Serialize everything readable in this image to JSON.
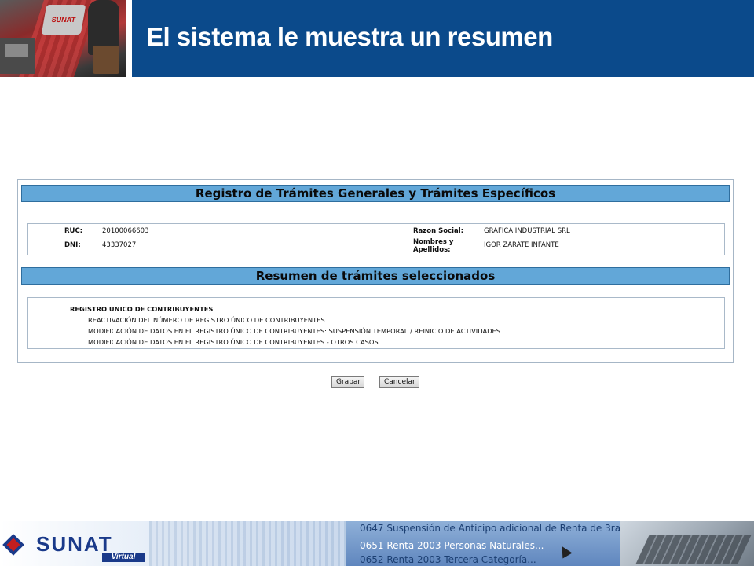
{
  "header": {
    "title": "El sistema le muestra un resumen",
    "photo_sign": "SUNAT"
  },
  "panel": {
    "section1_title": "Registro de Trámites Generales y Trámites Específicos",
    "fields": {
      "ruc_label": "RUC:",
      "ruc_value": "20100066603",
      "dni_label": "DNI:",
      "dni_value": "43337027",
      "razon_label": "Razon Social:",
      "razon_value": "GRAFICA INDUSTRIAL SRL",
      "nombres_label_1": "Nombres y",
      "nombres_label_2": "Apellidos:",
      "nombres_value": "IGOR ZARATE INFANTE"
    },
    "section2_title": "Resumen de trámites seleccionados",
    "summary": {
      "group": "REGISTRO UNICO DE CONTRIBUYENTES",
      "items": [
        "REACTIVACIÓN DEL NÚMERO DE REGISTRO ÚNICO DE CONTRIBUYENTES",
        "MODIFICACIÓN DE DATOS EN EL REGISTRO ÚNICO DE CONTRIBUYENTES: SUSPENSIÓN TEMPORAL / REINICIO DE ACTIVIDADES",
        "MODIFICACIÓN DE DATOS EN EL REGISTRO ÚNICO DE CONTRIBUYENTES - OTROS CASOS"
      ]
    }
  },
  "buttons": {
    "grabar": "Grabar",
    "cancelar": "Cancelar"
  },
  "footer": {
    "logo_text": "SUNAT",
    "logo_sub": "Virtual",
    "screen_lines": [
      "0647 Suspensión de Anticipo adicional de Renta de 3ra...",
      "0651 Renta 2003 Personas Naturales...",
      "0652 Renta 2003 Tercera Categoría..."
    ]
  },
  "colors": {
    "header_blue": "#0b4a8b",
    "section_header": "#62a7d8"
  }
}
